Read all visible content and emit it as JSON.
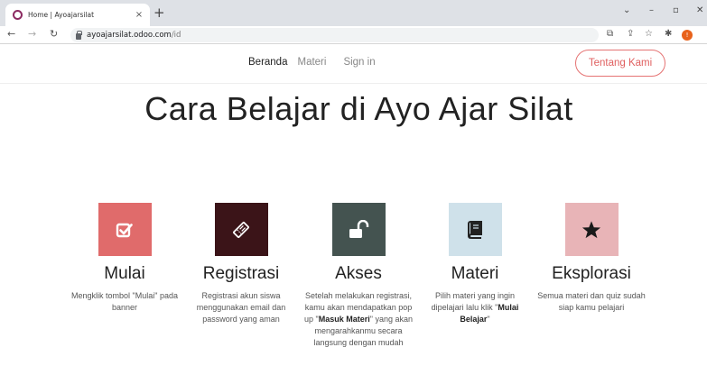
{
  "browser": {
    "tab_title": "Home | Ayoajarsilat",
    "tab_close": "×",
    "new_tab": "+",
    "url_host": "ayoajarsilat.odoo.com",
    "url_path": "/id",
    "avatar_letter": "!"
  },
  "nav": {
    "items": [
      "Beranda",
      "Materi",
      "Sign in"
    ],
    "active": "Beranda",
    "cta_label": "Tentang Kami"
  },
  "main": {
    "title": "Cara Belajar di Ayo Ajar Silat",
    "steps": [
      {
        "title": "Mulai",
        "desc": "Mengklik tombol \"Mulai\" pada banner",
        "icon": "checkbox-icon",
        "color": "#e06b6b"
      },
      {
        "title": "Registrasi",
        "desc": "Registrasi akun siswa menggunakan email dan password yang aman",
        "icon": "ticket-icon",
        "color": "#3b1418"
      },
      {
        "title": "Akses",
        "desc_before": "Setelah melakukan registrasi, kamu akan mendapatkan pop up \"",
        "desc_bold": "Masuk Materi",
        "desc_after": "\" yang akan mengarahkanmu secara langsung dengan mudah",
        "icon": "unlock-icon",
        "color": "#445350"
      },
      {
        "title": "Materi",
        "desc_before": "Pilih materi yang ingin dipelajari lalu klik \"",
        "desc_bold": "Mulai Belajar",
        "desc_after": "\"",
        "icon": "book-icon",
        "color": "#cfe1ea"
      },
      {
        "title": "Eksplorasi",
        "desc": "Semua materi dan quiz sudah siap kamu pelajari",
        "icon": "star-icon",
        "color": "#e8b4b7"
      }
    ]
  }
}
